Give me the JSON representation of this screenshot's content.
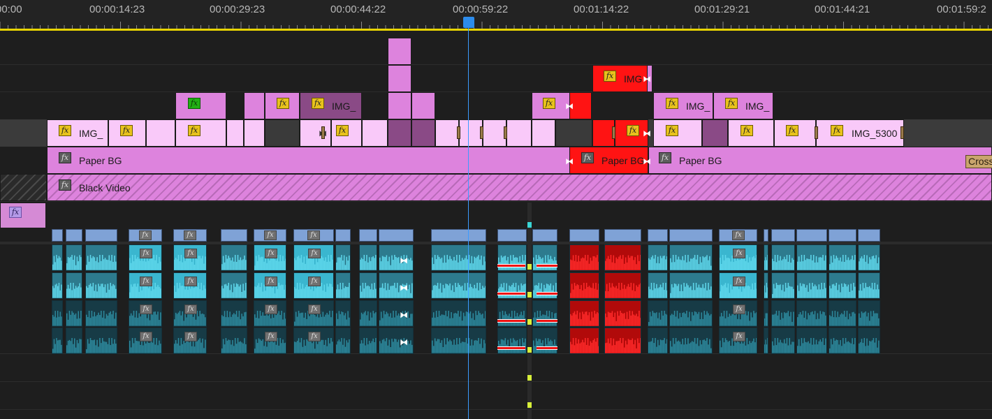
{
  "ruler": {
    "timecodes": [
      "00:00",
      "00:00:14:23",
      "00:00:29:23",
      "00:00:44:22",
      "00:00:59:22",
      "00:01:14:22",
      "00:01:29:21",
      "00:01:44:21",
      "00:01:59:2"
    ]
  },
  "clips": {
    "v5_img": "IMG",
    "v4_img_a": "IMG_",
    "v4_img_b": "IMG_",
    "v4_img_c": "IMG_",
    "v3_img_a": "IMG_",
    "v3_img_b": "IMG_5300",
    "v2_paper_a": "Paper BG",
    "v2_paper_b": "Paper BG",
    "v2_paper_c": "Paper BG",
    "v2_cross": "Cross",
    "v1_black": "Black Video"
  },
  "fx_glyph": "fx",
  "transition_glyph": "⧓",
  "colors": {
    "clip_pink": "#dd83dd",
    "clip_light_pink": "#f9c9f9",
    "clip_purple": "#8a4a86",
    "clip_red": "#ff1313",
    "audio_teal": "#2d7b8e",
    "audio_highlight": "#3ab6cf",
    "playhead_blue": "#2d8ceb",
    "ruler_yellow": "#e8d400"
  }
}
